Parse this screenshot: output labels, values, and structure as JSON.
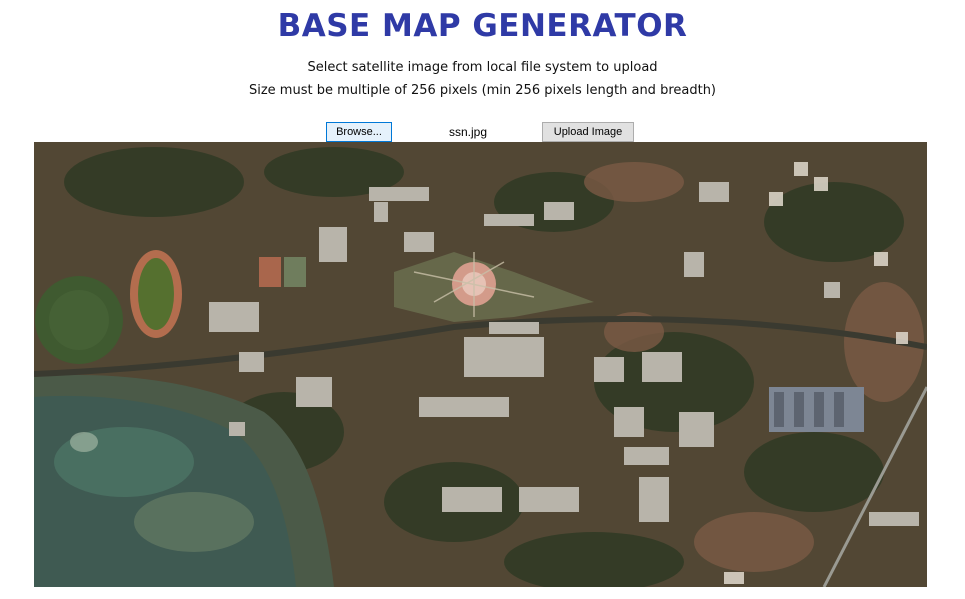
{
  "title": "BASE MAP GENERATOR",
  "subtitle_1": "Select satellite image from local file system to upload",
  "subtitle_2": "Size must be multiple of 256 pixels (min 256 pixels length and breadth)",
  "browse_label": "Browse...",
  "file_name": "ssn.jpg",
  "upload_label": "Upload Image",
  "colors": {
    "title": "#2f3aa6",
    "button_bg": "#e1e1e1",
    "button_focus_border": "#0078d7"
  }
}
